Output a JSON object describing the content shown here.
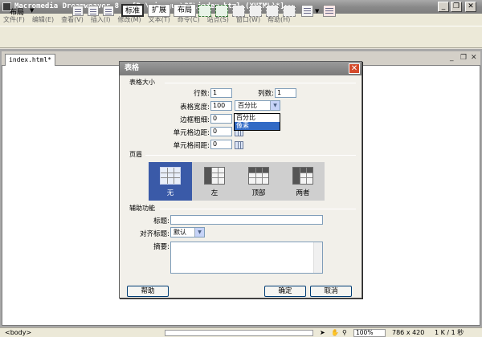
{
  "app": {
    "title": "Macromedia Dreamweaver 8 - [D:\\xiaoguo\\35\\index.html (XHTML)*]",
    "window_buttons": [
      "_",
      "❐",
      "✕"
    ]
  },
  "menu": [
    "文件(F)",
    "编辑(E)",
    "查看(V)",
    "插入(I)",
    "修改(M)",
    "文本(T)",
    "命令(C)",
    "站点(S)",
    "窗口(W)",
    "帮助(H)"
  ],
  "toolbar": {
    "layout_label": "布局",
    "mode_buttons": [
      "标准",
      "扩展",
      "布局"
    ]
  },
  "document": {
    "tab_label": "index.html*",
    "controls": [
      "_",
      "❐",
      "✕"
    ]
  },
  "dialog": {
    "title": "表格",
    "table_size_section": "表格大小",
    "rows_label": "行数:",
    "rows_value": "1",
    "cols_label": "列数:",
    "cols_value": "1",
    "width_label": "表格宽度:",
    "width_value": "100",
    "width_unit_selected": "百分比",
    "width_unit_options": [
      "百分比",
      "像素"
    ],
    "border_label": "边框粗细:",
    "border_value": "0",
    "padding_label": "单元格边距:",
    "padding_value": "0",
    "spacing_label": "单元格间距:",
    "spacing_value": "0",
    "header_section": "页眉",
    "header_options": [
      "无",
      "左",
      "顶部",
      "两者"
    ],
    "header_selected": "无",
    "accessibility_section": "辅助功能",
    "caption_label": "标题:",
    "caption_value": "",
    "align_caption_label": "对齐标题:",
    "align_caption_value": "默认",
    "summary_label": "摘要:",
    "summary_value": "",
    "help_button": "帮助",
    "ok_button": "确定",
    "cancel_button": "取消"
  },
  "status": {
    "tag": "<body>",
    "zoom": "100%",
    "size": "786 x 420",
    "filesize": "1 K / 1 秒"
  },
  "colors": {
    "accent_selected": "#3a5aa8",
    "close_button": "#d44a2a"
  }
}
